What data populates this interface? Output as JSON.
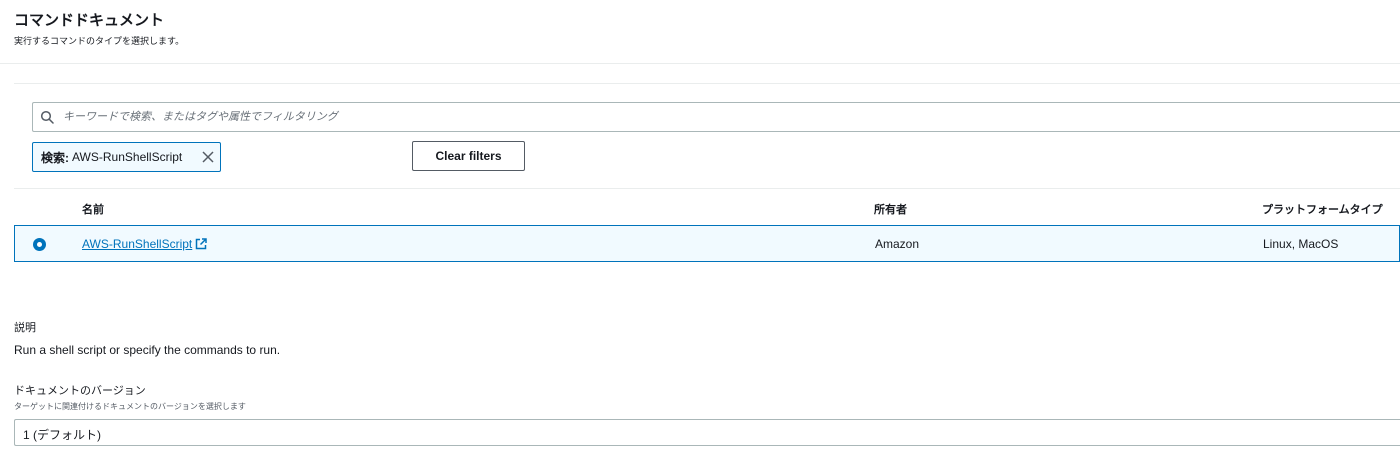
{
  "header": {
    "title": "コマンドドキュメント",
    "subtitle": "実行するコマンドのタイプを選択します。"
  },
  "filter": {
    "placeholder": "キーワードで検索、またはタグや属性でフィルタリング",
    "token_key": "検索:",
    "token_value": "AWS-RunShellScript",
    "clear_label": "Clear filters"
  },
  "table": {
    "columns": [
      "名前",
      "所有者",
      "プラットフォームタイプ"
    ],
    "rows": [
      {
        "name": "AWS-RunShellScript",
        "owner": "Amazon",
        "platform": "Linux, MacOS",
        "selected": true
      }
    ]
  },
  "description": {
    "label": "説明",
    "text": "Run a shell script or specify the commands to run."
  },
  "version": {
    "label": "ドキュメントのバージョン",
    "hint": "ターゲットに関連付けるドキュメントのバージョンを選択します",
    "value": "1 (デフォルト)"
  },
  "colors": {
    "accent": "#0073bb",
    "selected_bg": "#f1faff",
    "border": "#aab7b8"
  },
  "icons": [
    "search-icon",
    "close-icon",
    "external-link-icon",
    "radio-selected-icon"
  ]
}
